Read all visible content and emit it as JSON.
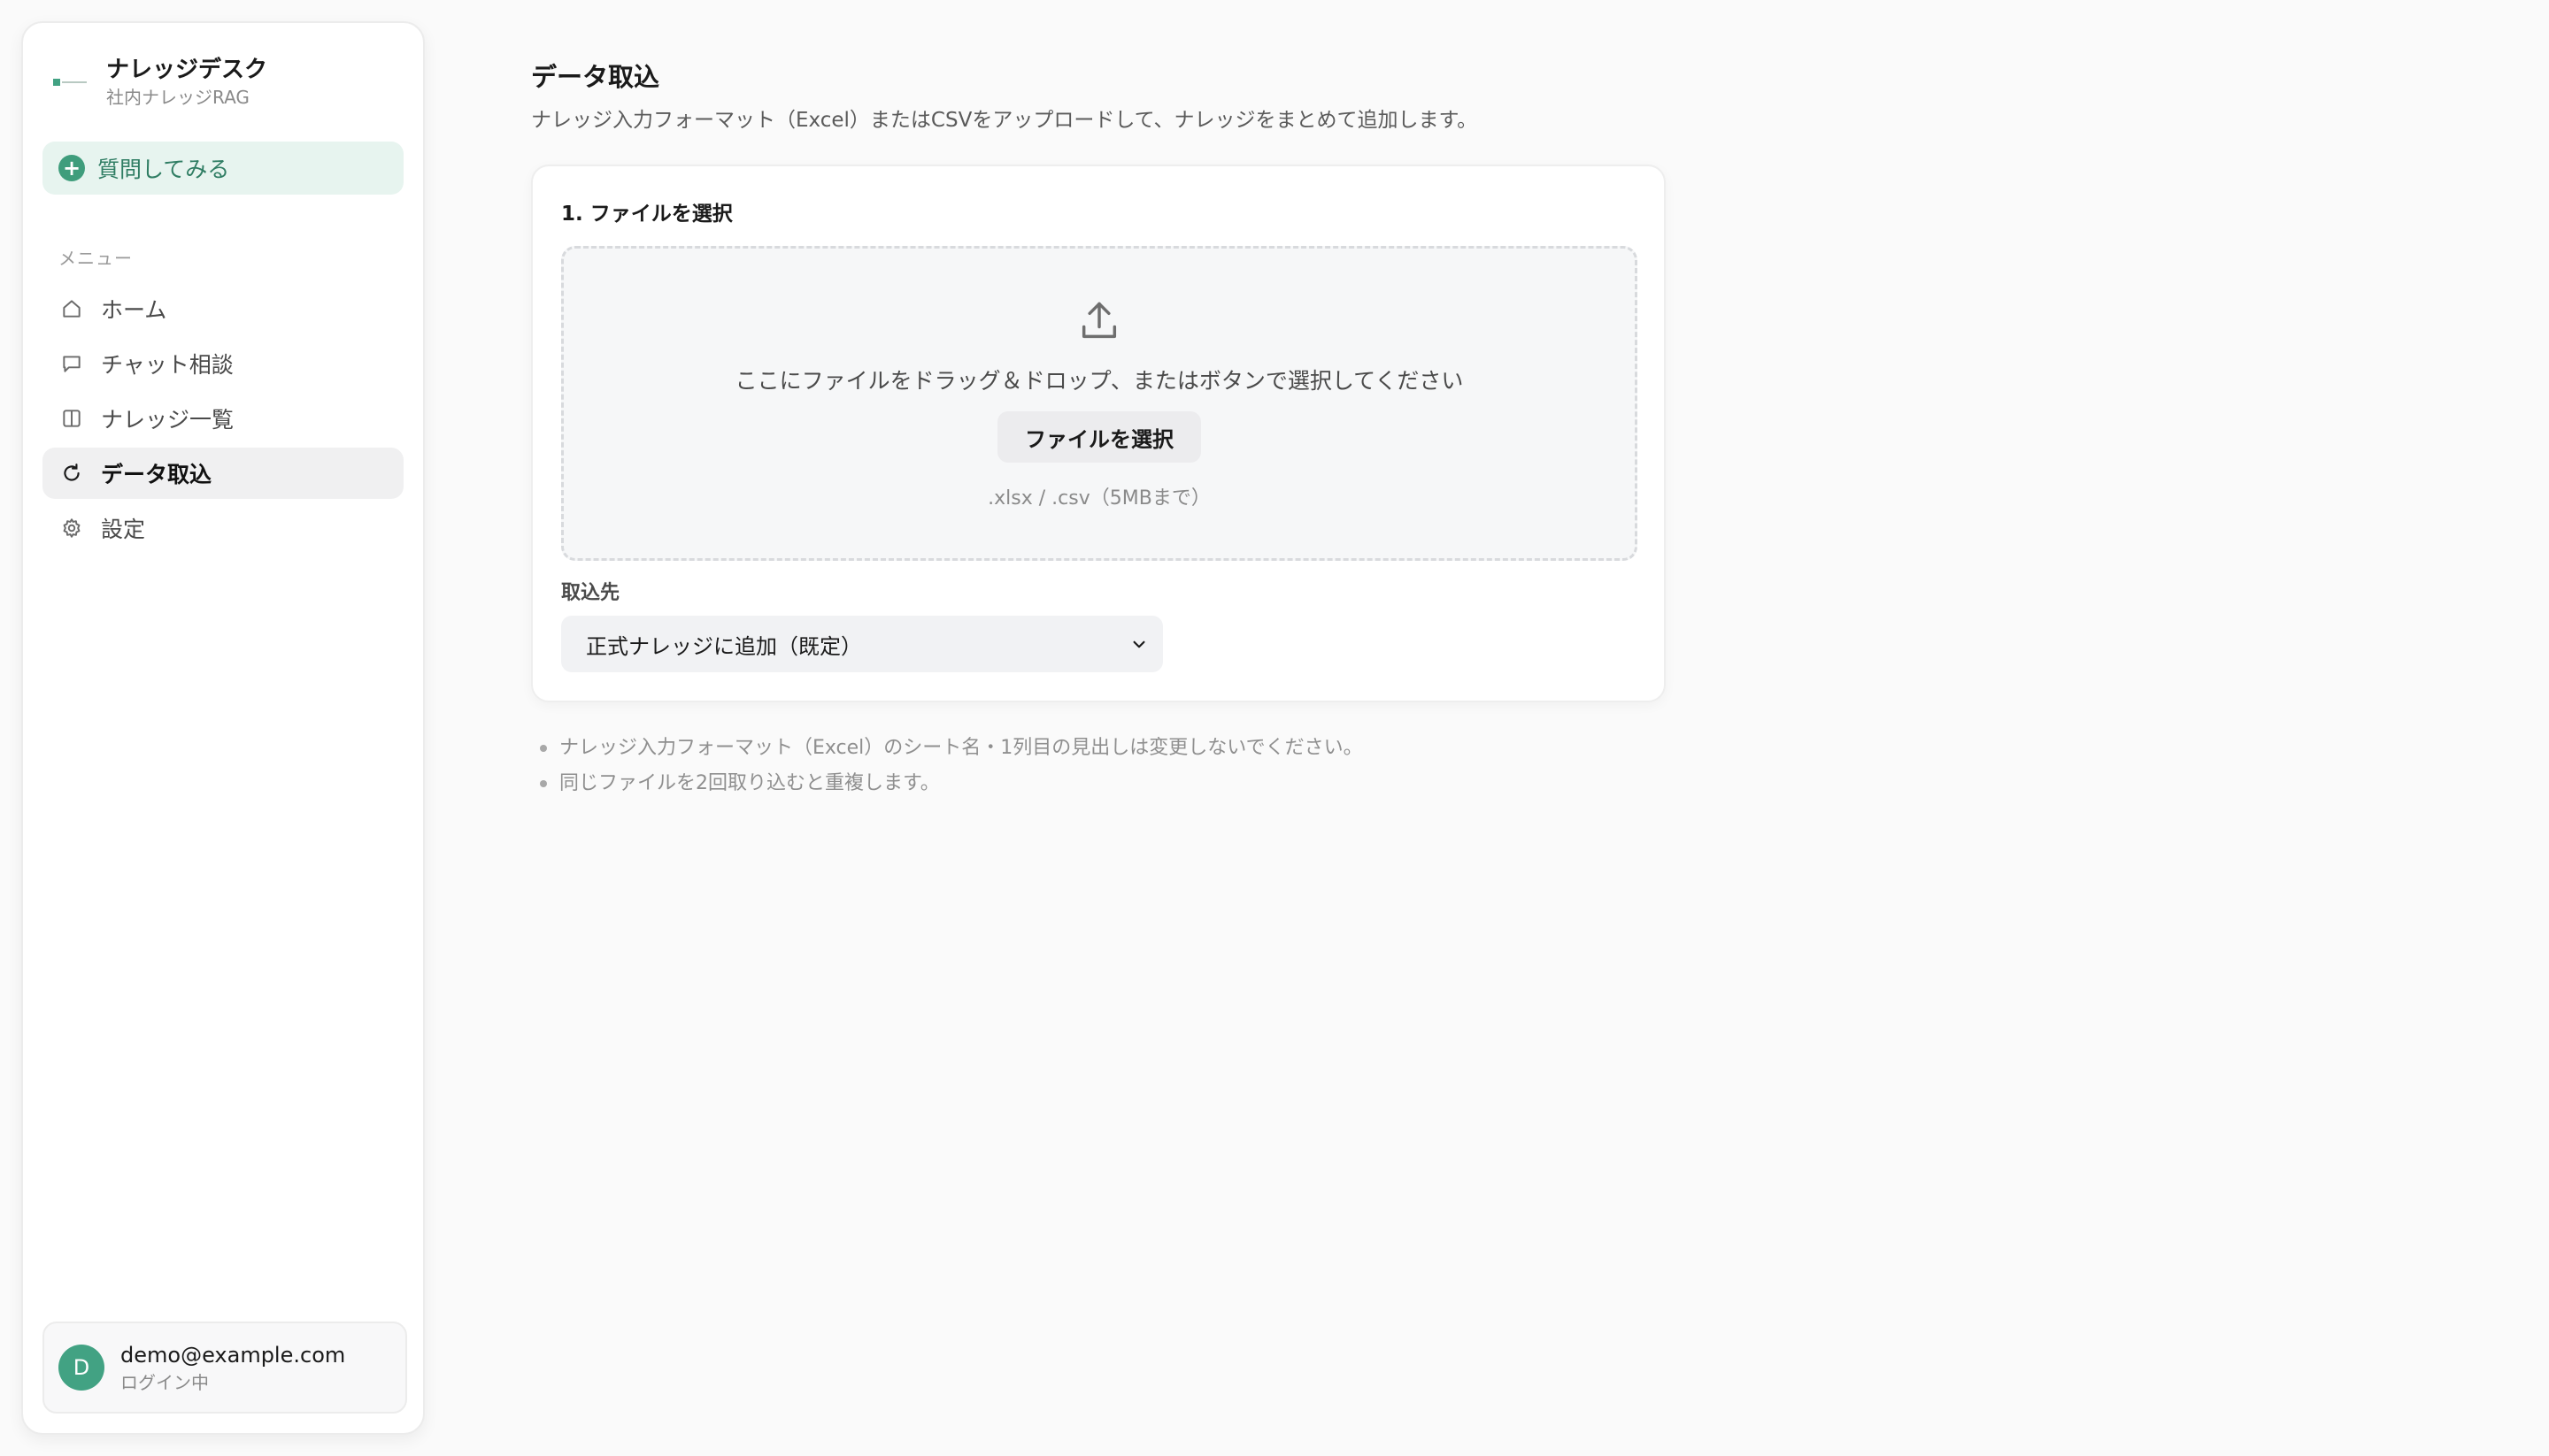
{
  "sidebar": {
    "brand_name": "ナレッジデスク",
    "brand_sub": "社内ナレッジRAG",
    "ask_label": "質問してみる",
    "menu_heading": "メニュー",
    "items": [
      {
        "label": "ホーム",
        "icon": "home-icon",
        "active": false
      },
      {
        "label": "チャット相談",
        "icon": "chat-icon",
        "active": false
      },
      {
        "label": "ナレッジ一覧",
        "icon": "book-icon",
        "active": false
      },
      {
        "label": "データ取込",
        "icon": "refresh-icon",
        "active": true
      },
      {
        "label": "設定",
        "icon": "gear-icon",
        "active": false
      }
    ],
    "user": {
      "avatar_initial": "D",
      "email": "demo@example.com",
      "status": "ログイン中"
    }
  },
  "main": {
    "title": "データ取込",
    "description": "ナレッジ入力フォーマット（Excel）またはCSVをアップロードして、ナレッジをまとめて追加します。",
    "card": {
      "section_title": "1. ファイルを選択",
      "drop_text": "ここにファイルをドラッグ＆ドロップ、またはボタンで選択してください",
      "choose_button": "ファイルを選択",
      "hint": ".xlsx / .csv（5MBまで）",
      "dest_label": "取込先",
      "dest_value": "正式ナレッジに追加（既定）"
    },
    "notes": [
      "ナレッジ入力フォーマット（Excel）のシート名・1列目の見出しは変更しないでください。",
      "同じファイルを2回取り込むと重複します。"
    ]
  },
  "colors": {
    "accent": "#42a283",
    "accent_soft": "#e7f4ef",
    "accent_text": "#2f7d63",
    "background": "#fafafa"
  }
}
